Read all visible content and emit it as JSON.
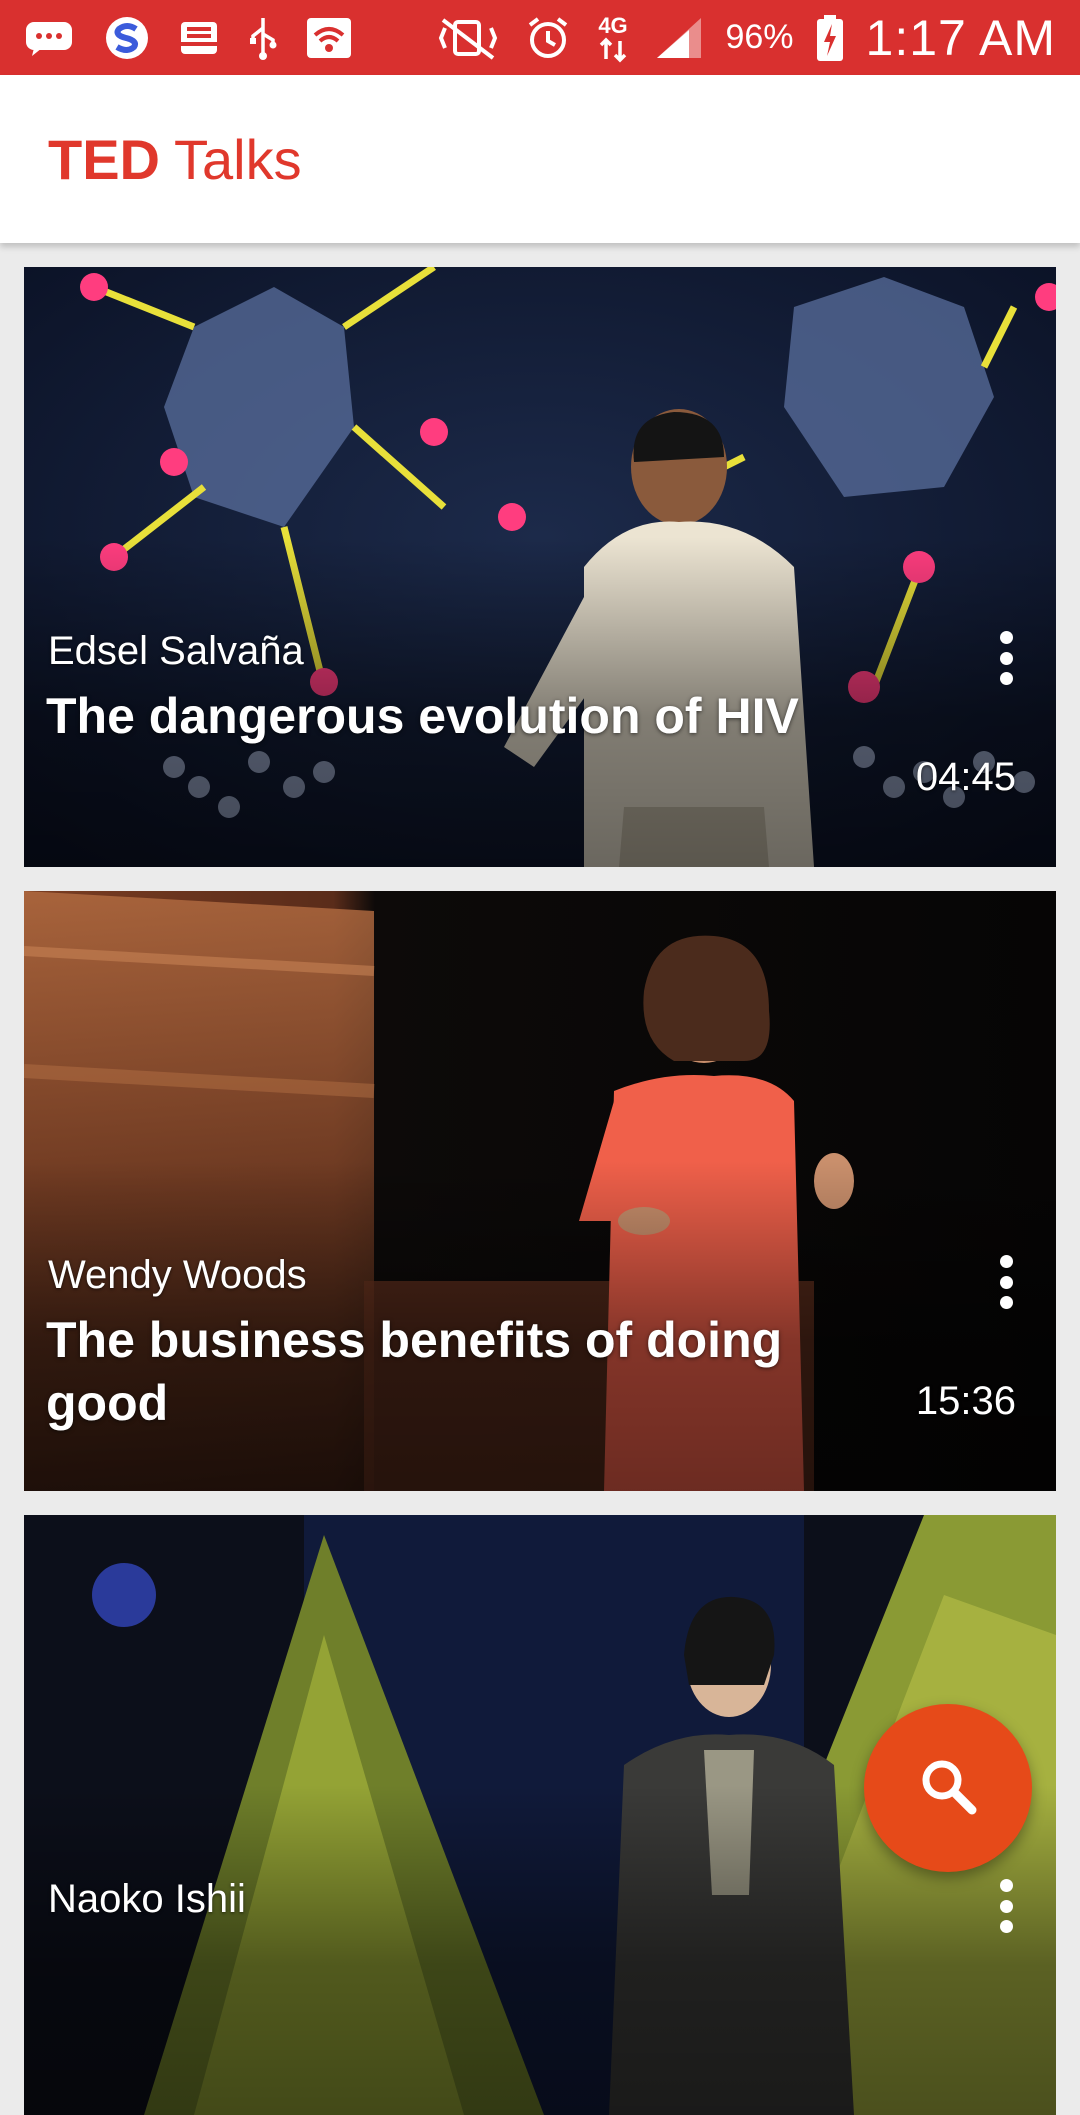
{
  "status_bar": {
    "battery_percent": "96%",
    "time": "1:17 AM",
    "network_label": "4G",
    "background_color": "#d9302f",
    "icons": [
      "messenger-icon",
      "s-logo-icon",
      "inbox-icon",
      "usb-icon",
      "wifi-icon",
      "vibrate-mute-icon",
      "alarm-icon",
      "network-4g-icon",
      "signal-icon",
      "battery-charging-icon"
    ]
  },
  "app_bar": {
    "brand": "TED",
    "title": "Talks",
    "title_color": "#e0382c"
  },
  "talks": [
    {
      "speaker": "Edsel Salvaña",
      "title": "The dangerous evolution of HIV",
      "duration": "04:45",
      "menu_icon": "more-vert-icon"
    },
    {
      "speaker": "Wendy Woods",
      "title": "The business benefits of doing good",
      "duration": "15:36",
      "menu_icon": "more-vert-icon"
    },
    {
      "speaker": "Naoko Ishii",
      "title": "",
      "duration": "",
      "menu_icon": "more-vert-icon"
    }
  ],
  "fab": {
    "icon": "search-icon",
    "color": "#e64a19"
  }
}
